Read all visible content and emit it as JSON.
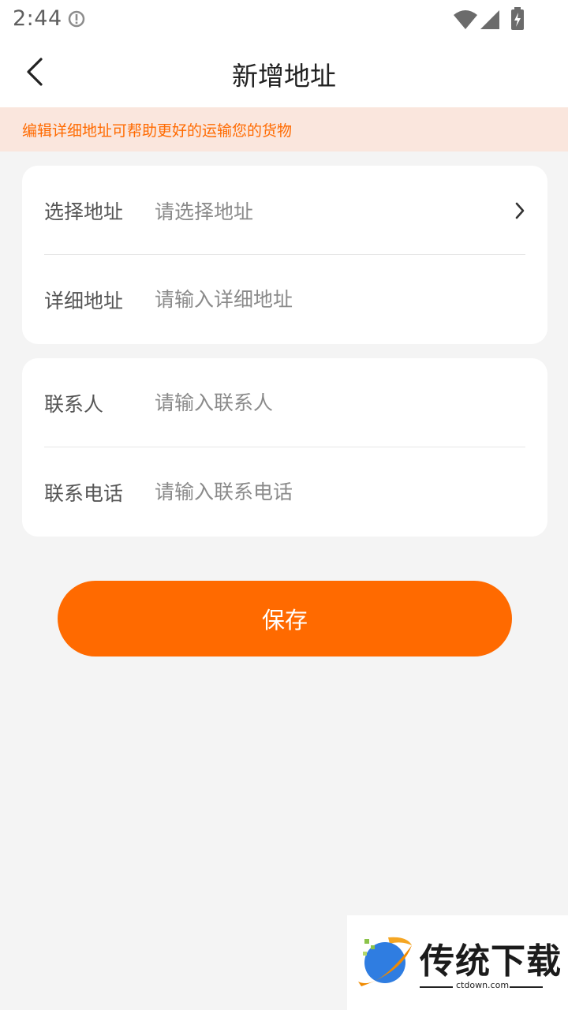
{
  "status_bar": {
    "time": "2:44"
  },
  "header": {
    "title": "新增地址"
  },
  "notice": {
    "text": "编辑详细地址可帮助更好的运输您的货物"
  },
  "address_card": {
    "select_label": "选择地址",
    "select_placeholder": "请选择地址",
    "detail_label": "详细地址",
    "detail_placeholder": "请输入详细地址"
  },
  "contact_card": {
    "name_label": "联系人",
    "name_placeholder": "请输入联系人",
    "phone_label": "联系电话",
    "phone_placeholder": "请输入联系电话"
  },
  "actions": {
    "save_label": "保存"
  },
  "watermark": {
    "title": "传统下载",
    "url": "ctdown.com"
  },
  "colors": {
    "accent": "#ff6a00",
    "notice_background": "#fae6dd",
    "page_background": "#f4f4f4"
  },
  "icons": [
    "info-icon",
    "wifi-icon",
    "signal-icon",
    "battery-charging-icon",
    "back-arrow-icon",
    "chevron-right-icon",
    "watermark-logo-icon"
  ]
}
